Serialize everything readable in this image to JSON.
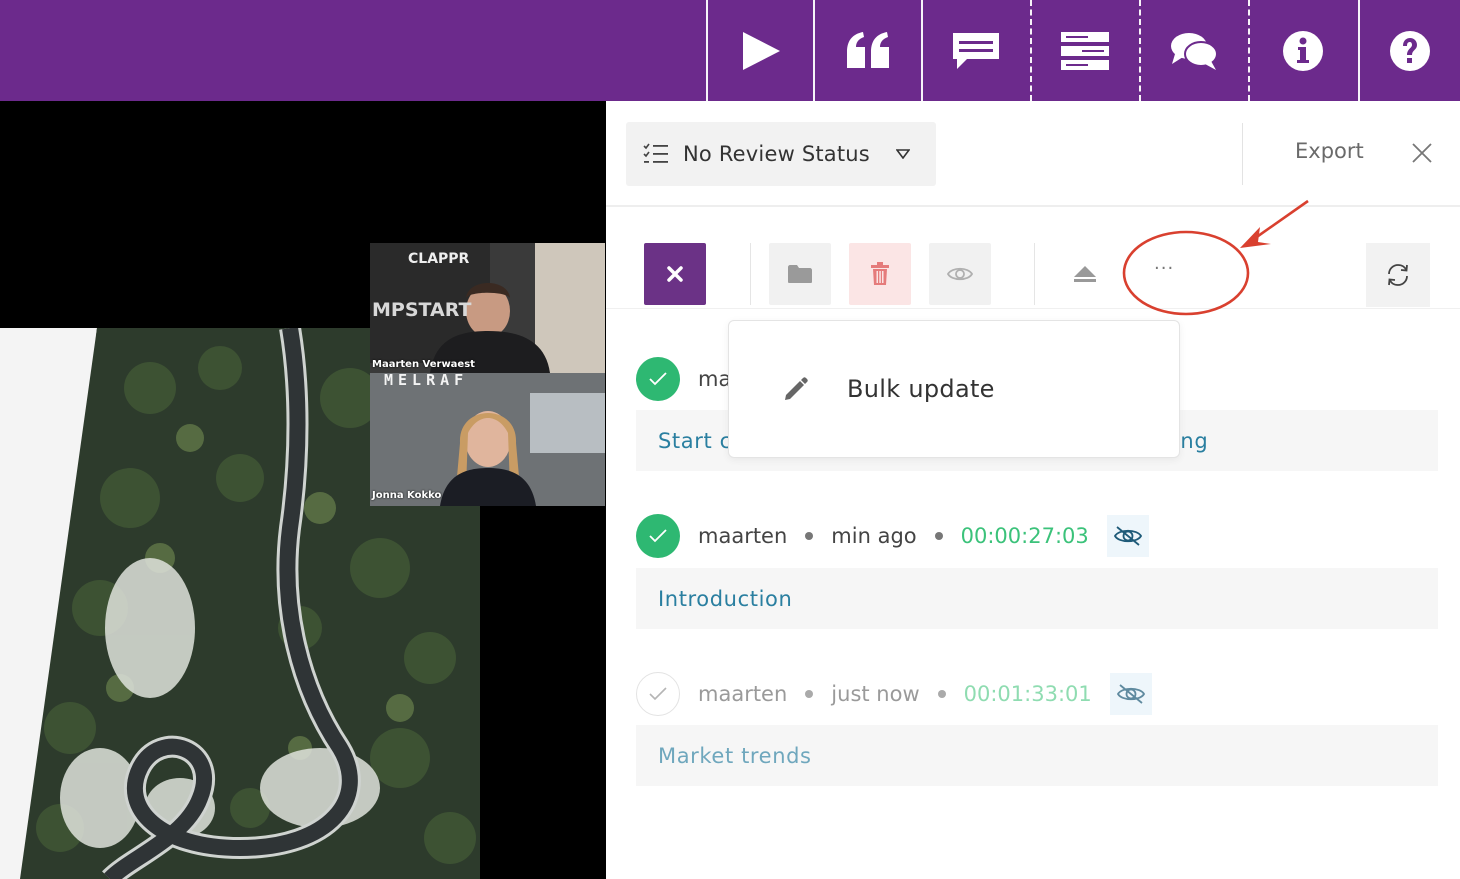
{
  "topbar": {
    "bg_color": "#6c2a8c",
    "buttons": [
      {
        "name": "play-icon"
      },
      {
        "name": "quote-icon"
      },
      {
        "name": "comment-icon"
      },
      {
        "name": "list-icon"
      },
      {
        "name": "chat-icon"
      },
      {
        "name": "info-icon"
      },
      {
        "name": "help-icon"
      }
    ]
  },
  "video": {
    "pip": {
      "top_label": "CLAPPR",
      "banner_text": "MPSTART",
      "person1_name": "Maarten Verwaest",
      "overlay_text": "MELRAF",
      "person2_name": "Jonna Kokko"
    }
  },
  "panel": {
    "review_status": "No Review Status",
    "export_label": "Export",
    "toolbar": {
      "more_label": "···"
    },
    "dropdown": {
      "items": [
        {
          "label": "Bulk update",
          "icon": "pencil-icon"
        }
      ]
    },
    "items": [
      {
        "user": "ma",
        "title_start": "Start c",
        "title_end": "ing",
        "checked": true
      },
      {
        "user": "maarten",
        "ago": "min ago",
        "timecode": "00:00:27:03",
        "title": "Introduction",
        "checked": true
      },
      {
        "user": "maarten",
        "ago": "just now",
        "timecode": "00:01:33:01",
        "title": "Market trends",
        "checked": false
      }
    ]
  },
  "colors": {
    "accent_purple": "#6b3286",
    "check_green": "#2eb872",
    "timecode_green": "#3bc27a",
    "title_blue": "#2a7fa0",
    "annotation_red": "#d9402f"
  }
}
